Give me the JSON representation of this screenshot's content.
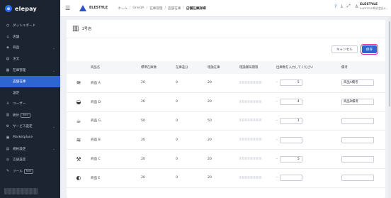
{
  "sidebar": {
    "logo_text": "elepay",
    "items": [
      {
        "icon": "dashboard-icon",
        "glyph": "◷",
        "label": "ダッシュボード",
        "chevron": false,
        "beta": false
      },
      {
        "icon": "store-icon",
        "glyph": "⌂",
        "label": "店舗",
        "chevron": false,
        "beta": false
      },
      {
        "icon": "product-icon",
        "glyph": "◈",
        "label": "商品",
        "chevron": true,
        "beta": false
      },
      {
        "icon": "order-icon",
        "glyph": "▤",
        "label": "注文",
        "chevron": false,
        "beta": false
      },
      {
        "icon": "inventory-icon",
        "glyph": "▦",
        "label": "在庫管理",
        "chevron": true,
        "beta": false
      },
      {
        "icon": "",
        "glyph": "",
        "label": "店舗在庫",
        "chevron": false,
        "beta": false,
        "sub": true,
        "active": true
      },
      {
        "icon": "",
        "glyph": "",
        "label": "設定",
        "chevron": false,
        "beta": false,
        "sub": true
      },
      {
        "icon": "user-icon",
        "glyph": "♙",
        "label": "ユーザー",
        "chevron": false,
        "beta": false
      },
      {
        "icon": "stats-icon",
        "glyph": "▥",
        "label": "統計",
        "chevron": false,
        "beta": true
      },
      {
        "icon": "service-icon",
        "glyph": "⚙",
        "label": "サービス設定",
        "chevron": true,
        "beta": false
      },
      {
        "icon": "marketplace-icon",
        "glyph": "▣",
        "label": "Marketplace",
        "chevron": false,
        "beta": false
      },
      {
        "icon": "rules-icon",
        "glyph": "▤",
        "label": "規約設定",
        "chevron": true,
        "beta": false
      },
      {
        "icon": "language-icon",
        "glyph": "◎",
        "label": "言語設定",
        "chevron": false,
        "beta": false
      },
      {
        "icon": "tool-icon",
        "glyph": "✎",
        "label": "ツール",
        "chevron": false,
        "beta": true
      }
    ],
    "beta_label": "Beta"
  },
  "header": {
    "shop_name": "ELESTYLE",
    "breadcrumb": [
      "ホーム",
      "OneQA",
      "在庫管理",
      "店舗在庫",
      "店舗在庫詳細"
    ],
    "user_name": "ELESTYLE",
    "user_company": "ELESTYLE株式会社X..."
  },
  "main": {
    "store_name": "1号店",
    "cancel_label": "キャンセル",
    "save_label": "保存",
    "columns": [
      "",
      "商品名",
      "標準在庫数",
      "在庫差分",
      "理論在庫",
      "理論賞味期限",
      "出庫数を入力してください",
      "備考"
    ],
    "rows": [
      {
        "icon": "bowl-icon",
        "glyph": "≋",
        "name": "商品 A",
        "std": "20",
        "diff": "0",
        "theo": "20",
        "qty": "5",
        "note": "商品A備考"
      },
      {
        "icon": "dish-icon",
        "glyph": "◒",
        "name": "商品 D",
        "std": "20",
        "diff": "0",
        "theo": "20",
        "qty": "4",
        "note": "商品D備考"
      },
      {
        "icon": "cup-icon",
        "glyph": "☕",
        "name": "商品 G",
        "std": "50",
        "diff": "0",
        "theo": "50",
        "qty": "1",
        "note": ""
      },
      {
        "icon": "bowl-icon",
        "glyph": "≋",
        "name": "商品 B",
        "std": "20",
        "diff": "0",
        "theo": "20",
        "qty": "",
        "note": ""
      },
      {
        "icon": "skewer-icon",
        "glyph": "⚒",
        "name": "商品 C",
        "std": "20",
        "diff": "0",
        "theo": "20",
        "qty": "5",
        "note": ""
      },
      {
        "icon": "roll-icon",
        "glyph": "◐",
        "name": "商品 E",
        "std": "20",
        "diff": "0",
        "theo": "20",
        "qty": "",
        "note": ""
      }
    ],
    "input_prefix": "-"
  }
}
